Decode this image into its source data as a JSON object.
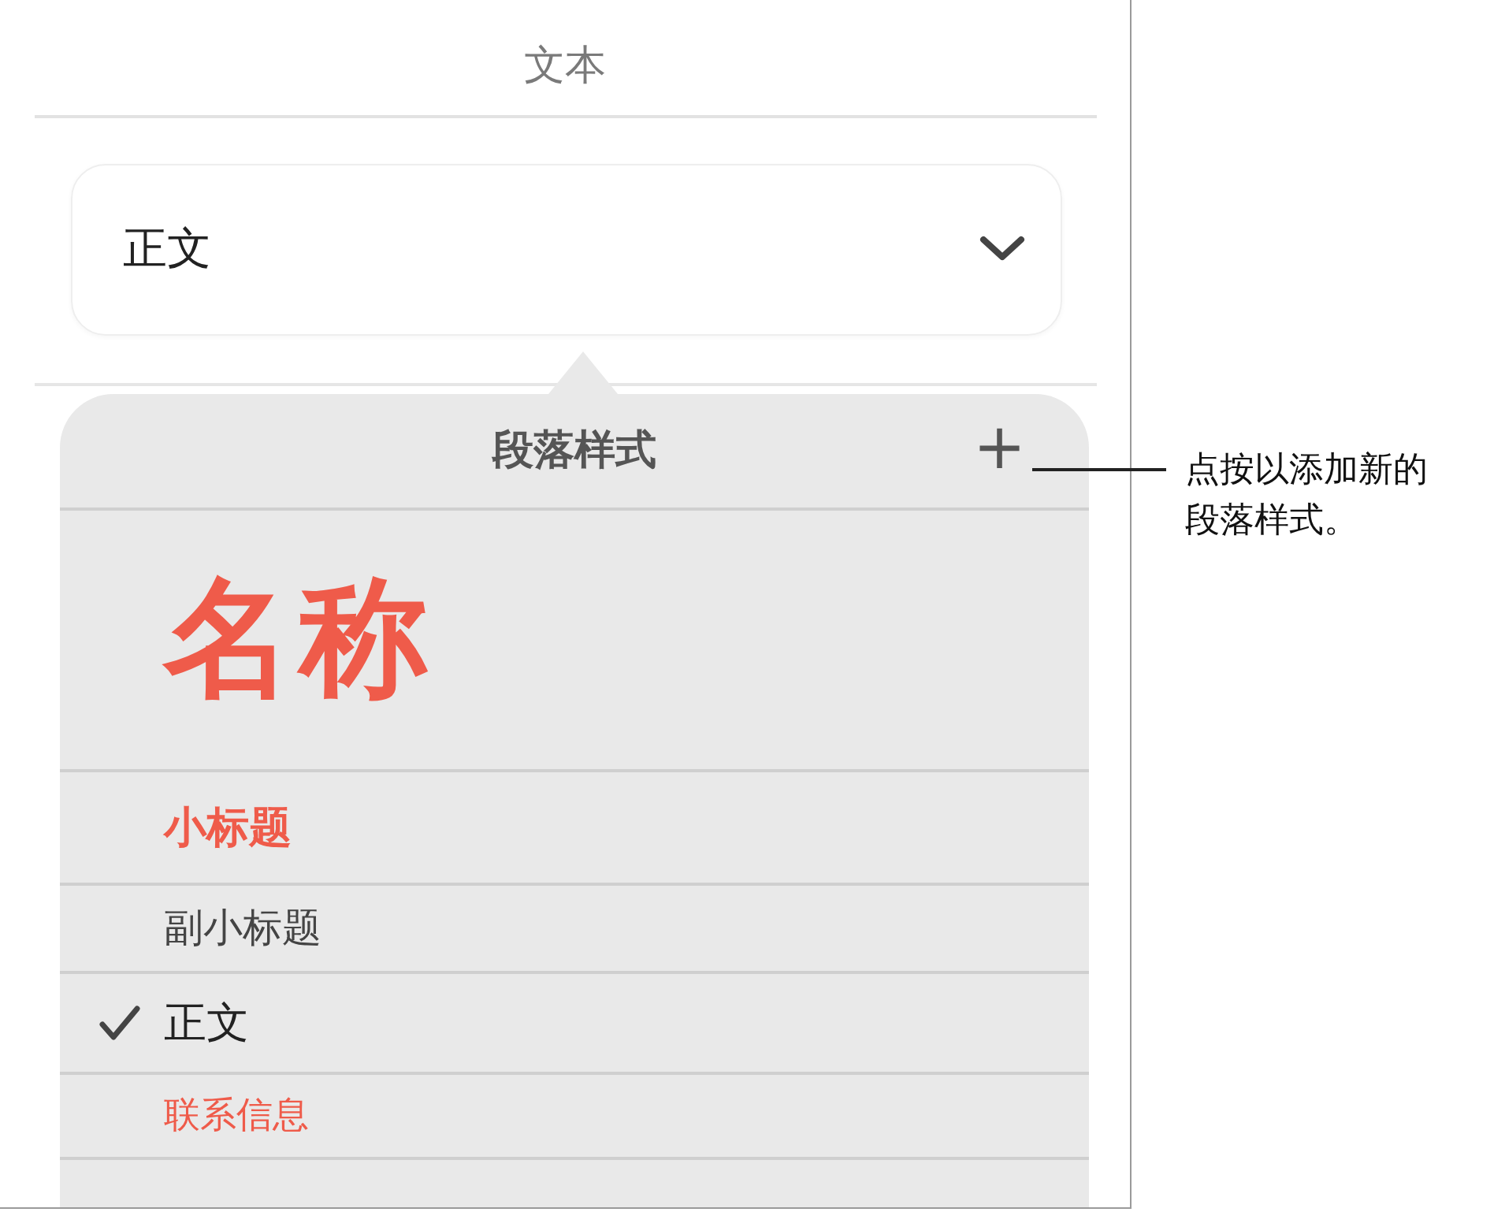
{
  "header": {
    "title": "文本"
  },
  "style_picker": {
    "value": "正文"
  },
  "popover": {
    "title": "段落样式",
    "add_label": "+",
    "styles": [
      {
        "label": "名称",
        "kind": "title",
        "selected": false
      },
      {
        "label": "小标题",
        "kind": "heading",
        "selected": false
      },
      {
        "label": "副小标题",
        "kind": "subheading",
        "selected": false
      },
      {
        "label": "正文",
        "kind": "body",
        "selected": true
      },
      {
        "label": "联系信息",
        "kind": "contact",
        "selected": false
      }
    ]
  },
  "callout": {
    "text": "点按以添加新的段落样式。"
  }
}
